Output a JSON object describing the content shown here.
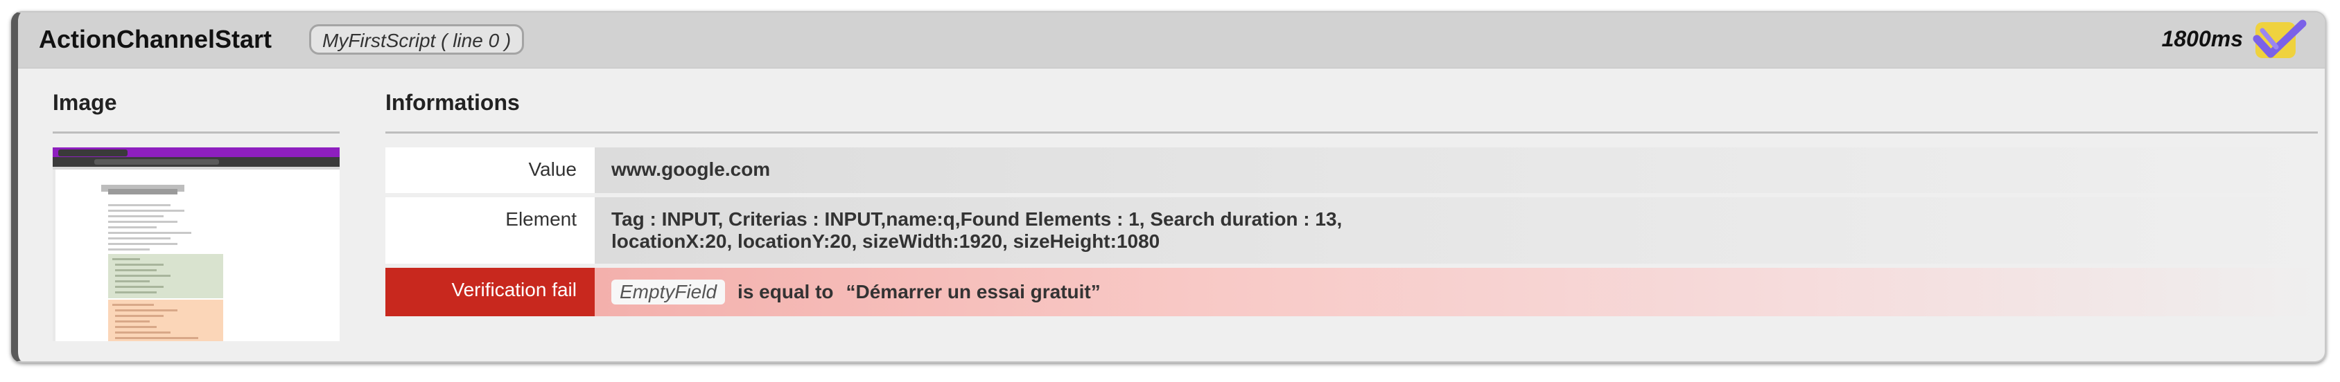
{
  "header": {
    "action_name": "ActionChannelStart",
    "script_badge": "MyFirstScript ( line 0 )",
    "duration": "1800ms",
    "status_icon": "check-icon"
  },
  "image_section": {
    "title": "Image",
    "thumbnail": "screenshot-thumbnail"
  },
  "info_section": {
    "title": "Informations",
    "rows": {
      "value": {
        "label": "Value",
        "text": "www.google.com"
      },
      "element": {
        "label": "Element",
        "line1": "Tag : INPUT, Criterias : INPUT,name:q,Found Elements : 1, Search duration : 13,",
        "line2": "locationX:20, locationY:20, sizeWidth:1920, sizeHeight:1080"
      },
      "verification": {
        "label": "Verification fail",
        "field": "EmptyField",
        "operator": "is equal to",
        "expected": "“Démarrer un essai gratuit”"
      }
    }
  },
  "colors": {
    "fail_red": "#c8281e",
    "header_bg": "#d2d2d2",
    "card_bg": "#efefef",
    "icon_purple": "#7b61e8",
    "icon_yellow": "#f2d22e"
  }
}
